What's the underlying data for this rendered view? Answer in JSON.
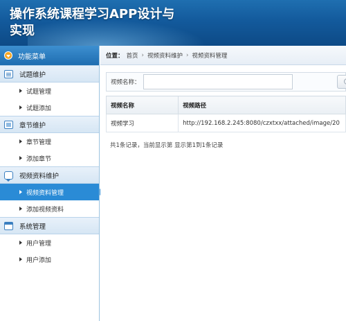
{
  "header": {
    "title": "操作系统课程学习APP设计与实现"
  },
  "sidebar": {
    "menu_title": "功能菜单",
    "groups": [
      {
        "label": "试题维护",
        "items": [
          {
            "label": "试题管理"
          },
          {
            "label": "试题添加"
          }
        ]
      },
      {
        "label": "章节维护",
        "items": [
          {
            "label": "章节管理"
          },
          {
            "label": "添加章节"
          }
        ]
      },
      {
        "label": "视频资料维护",
        "items": [
          {
            "label": "视频资料管理"
          },
          {
            "label": "添加视频资料"
          }
        ]
      },
      {
        "label": "系统管理",
        "items": [
          {
            "label": "用户管理"
          },
          {
            "label": "用户添加"
          }
        ]
      }
    ]
  },
  "breadcrumb": {
    "prefix": "位置：",
    "items": [
      "首页",
      "视频资料维护",
      "视频资料管理"
    ]
  },
  "search": {
    "label": "视频名称：",
    "value": ""
  },
  "table": {
    "headers": [
      "视频名称",
      "视频路径"
    ],
    "rows": [
      [
        "视频学习",
        "http://192.168.2.245:8080/czxtxx/attached/image/20"
      ]
    ]
  },
  "pager": {
    "text": "共1条记录，当前显示第 显示第1到1条记录"
  },
  "colors": {
    "header": "#135a9c",
    "active": "#2a8bd6",
    "menu_head": "#1e6db0"
  }
}
